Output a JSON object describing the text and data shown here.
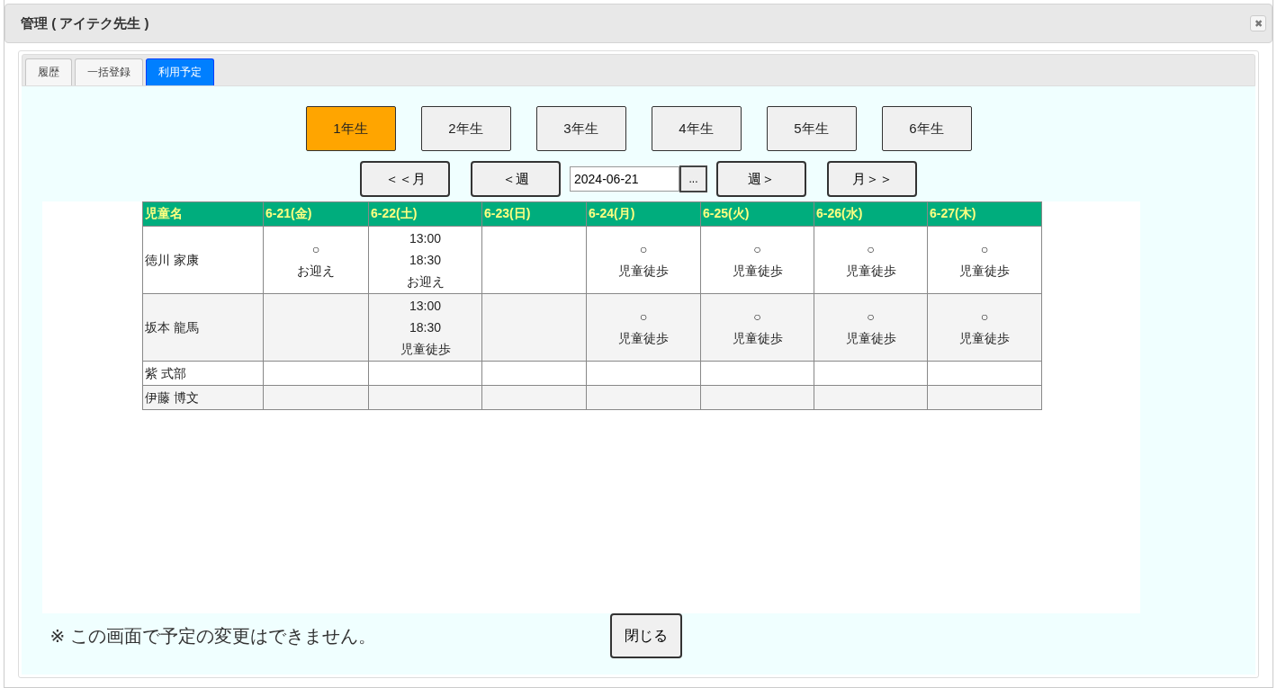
{
  "window": {
    "title": "管理 ( アイテク先生 )",
    "close": "✖"
  },
  "tabs": [
    {
      "label": "履歴",
      "selected": false
    },
    {
      "label": "一括登録",
      "selected": false
    },
    {
      "label": "利用予定",
      "selected": true
    }
  ],
  "grades": [
    {
      "label": "1年生",
      "selected": true
    },
    {
      "label": "2年生",
      "selected": false
    },
    {
      "label": "3年生",
      "selected": false
    },
    {
      "label": "4年生",
      "selected": false
    },
    {
      "label": "5年生",
      "selected": false
    },
    {
      "label": "6年生",
      "selected": false
    }
  ],
  "nav": {
    "prev_month": "＜＜月",
    "prev_week": "＜週",
    "date": "2024-06-21",
    "picker": "...",
    "next_week": "週＞",
    "next_month": "月＞＞"
  },
  "table": {
    "columns": [
      "児童名",
      "6-21(金)",
      "6-22(土)",
      "6-23(日)",
      "6-24(月)",
      "6-25(火)",
      "6-26(水)",
      "6-27(木)"
    ],
    "rows": [
      [
        "徳川 家康",
        "○\nお迎え",
        "13:00\n18:30\nお迎え",
        "",
        "○\n児童徒歩",
        "○\n児童徒歩",
        "○\n児童徒歩",
        "○\n児童徒歩"
      ],
      [
        "坂本 龍馬",
        "",
        "13:00\n18:30\n児童徒歩",
        "",
        "○\n児童徒歩",
        "○\n児童徒歩",
        "○\n児童徒歩",
        "○\n児童徒歩"
      ],
      [
        "紫 式部",
        "",
        "",
        "",
        "",
        "",
        "",
        ""
      ],
      [
        "伊藤 博文",
        "",
        "",
        "",
        "",
        "",
        "",
        ""
      ]
    ]
  },
  "footer": {
    "note": "※ この画面で予定の変更はできません。",
    "close_button": "閉じる"
  }
}
